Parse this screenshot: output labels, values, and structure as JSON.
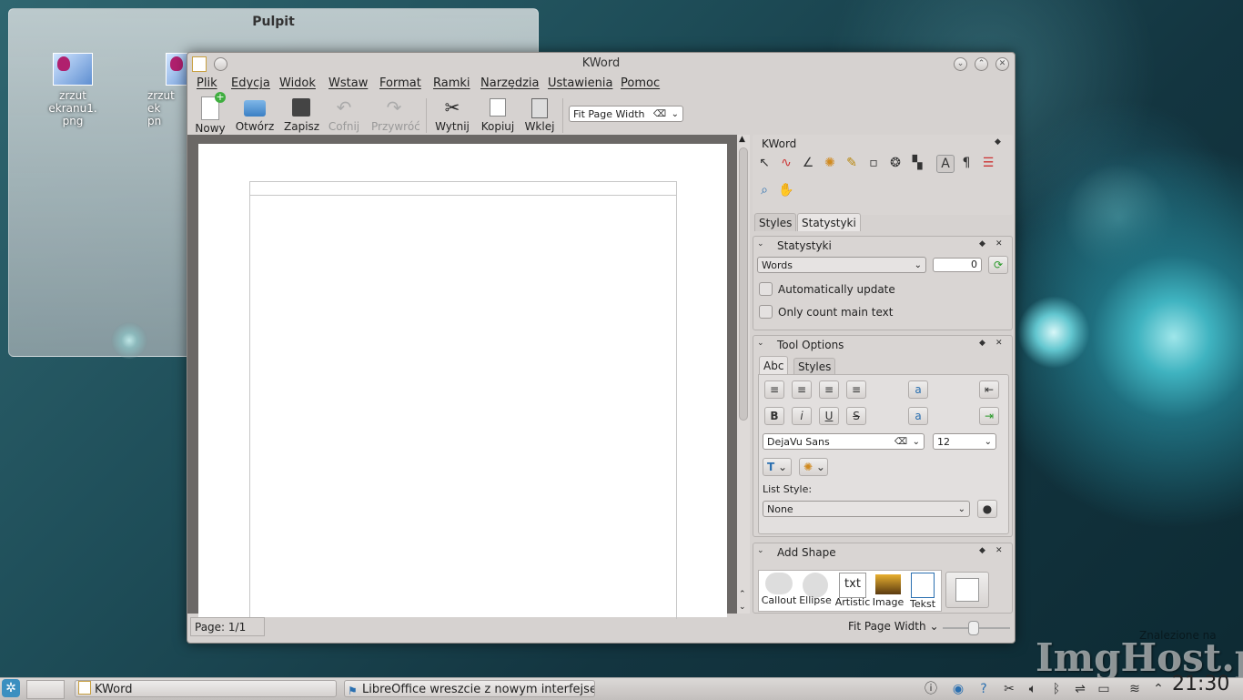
{
  "desktop": {
    "folderview_title": "Pulpit",
    "icons": [
      {
        "label": "zrzut ekranu1.\npng"
      },
      {
        "label": "zrzut ek\npn"
      }
    ],
    "watermark": "ImgHost.pl",
    "watermark_sub": "Znalezione na"
  },
  "window": {
    "title": "KWord",
    "menu": [
      "Plik",
      "Edycja",
      "Widok",
      "Wstaw",
      "Format",
      "Ramki",
      "Narzędzia",
      "Ustawienia",
      "Pomoc"
    ],
    "toolbar": {
      "new": "Nowy",
      "open": "Otwórz",
      "save": "Zapisz",
      "undo": "Cofnij",
      "redo": "Przywróć",
      "cut": "Wytnij",
      "copy": "Kopiuj",
      "paste": "Wklej",
      "zoom_value": "Fit Page Width"
    },
    "status": {
      "page": "Page: 1/1",
      "zoom": "Fit Page Width"
    }
  },
  "dock_kword": {
    "title": "KWord"
  },
  "dock_tabs": [
    "Styles",
    "Statystyki"
  ],
  "stats": {
    "title": "Statystyki",
    "mode": "Words",
    "count": "0",
    "auto_update": "Automatically update",
    "main_text": "Only count main text"
  },
  "tool_options": {
    "title": "Tool Options",
    "tabs": [
      "Abc",
      "Styles"
    ],
    "font": "DejaVu Sans",
    "size": "12",
    "list_style_label": "List Style:",
    "list_style": "None"
  },
  "add_shape": {
    "title": "Add Shape",
    "shapes": [
      "Callout",
      "Ellipse",
      "Artistic",
      "Image",
      "Tekst"
    ],
    "shape_txt_glyph": "txt"
  },
  "taskbar": {
    "tasks": [
      "KWord",
      "LibreOffice wreszcie z nowym interfejsem?"
    ],
    "clock": "21:30"
  },
  "colors": {
    "accent": "#3b8fc0",
    "window_bg": "#d6d2d0",
    "desktop": "#1e4d58"
  }
}
